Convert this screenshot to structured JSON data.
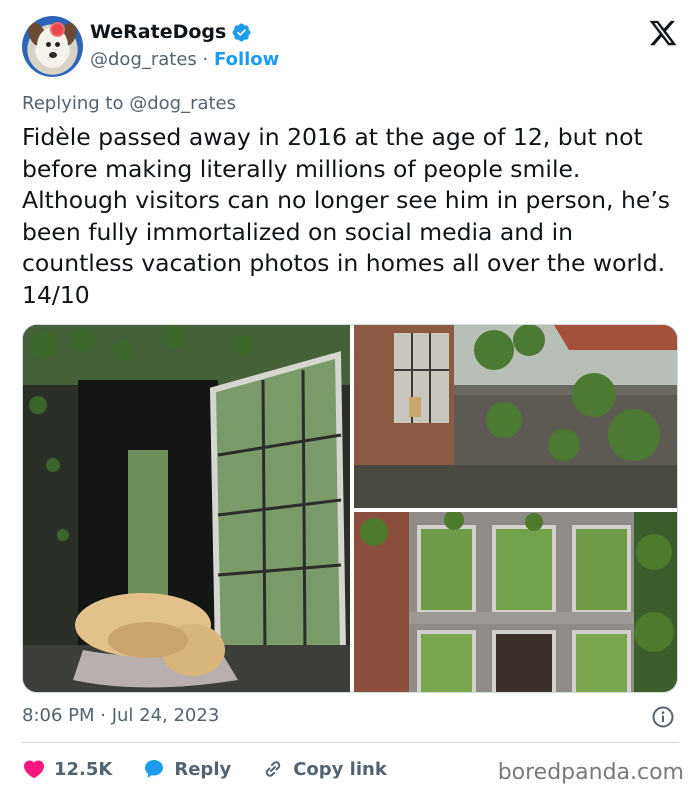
{
  "author": {
    "display_name": "WeRateDogs",
    "handle": "@dog_rates",
    "separator": "·",
    "follow_label": "Follow",
    "verified_color": "#1d9bf0"
  },
  "platform_logo": "x-logo-icon",
  "replying_to": "Replying to @dog_rates",
  "tweet_text": "Fidèle passed away in 2016 at the age of 12, but not before making literally millions of people smile. Although visitors can no longer see him in person, he’s been fully immortalized on social media and in countless vacation photos in homes all over the world. 14/10",
  "media": [
    {
      "icon": "photo-dog-in-window"
    },
    {
      "icon": "photo-building-wall-canal"
    },
    {
      "icon": "photo-ivy-windows"
    }
  ],
  "timestamp": "8:06 PM · Jul 24, 2023",
  "actions": {
    "likes_count": "12.5K",
    "reply_label": "Reply",
    "copy_link_label": "Copy link"
  },
  "watermark": "boredpanda.com",
  "colors": {
    "accent": "#1d9bf0",
    "like": "#f91880",
    "muted_text": "#536471",
    "text": "#0f1419"
  }
}
